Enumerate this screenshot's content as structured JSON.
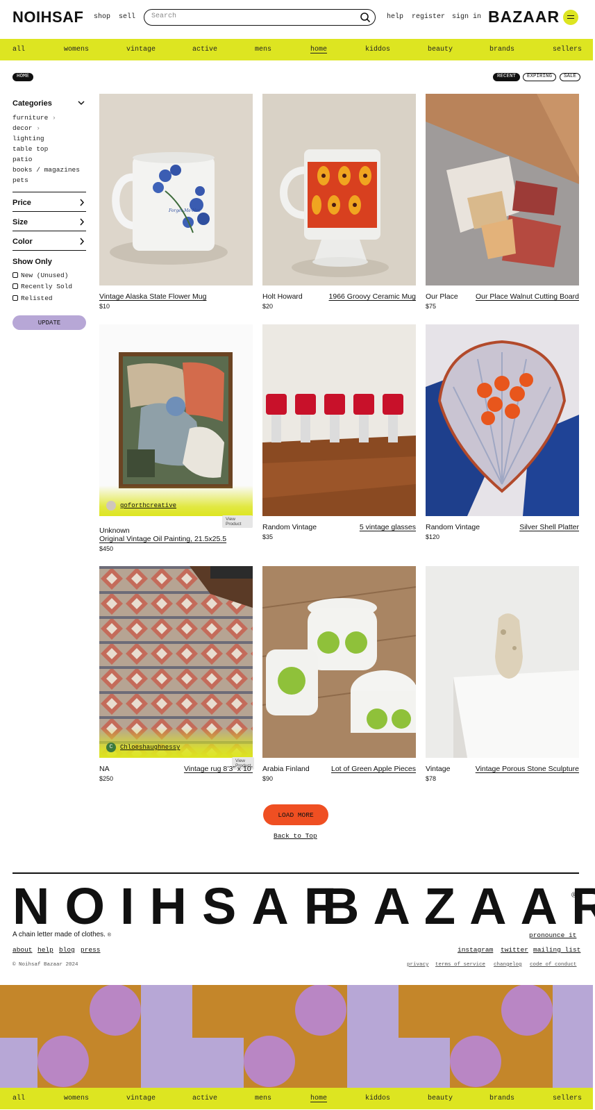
{
  "header": {
    "logo_left": "NOIHSAF",
    "shop": "shop",
    "sell": "sell",
    "search_placeholder": "Search",
    "help": "help",
    "register": "register",
    "sign_in": "sign in",
    "logo_right": "BAZAAR"
  },
  "nav": [
    "all",
    "womens",
    "vintage",
    "active",
    "mens",
    "home",
    "kiddos",
    "beauty",
    "brands",
    "sellers"
  ],
  "nav_active": "home",
  "breadcrumb": "HOME",
  "sort": [
    "RECENT",
    "EXPIRING",
    "SALE"
  ],
  "sidebar": {
    "categories_label": "Categories",
    "categories": [
      "furniture",
      "decor",
      "lighting",
      "table top",
      "patio",
      "books / magazines",
      "pets"
    ],
    "price_label": "Price",
    "size_label": "Size",
    "color_label": "Color",
    "show_only_label": "Show Only",
    "show_only": [
      "New (Unused)",
      "Recently Sold",
      "Relisted"
    ],
    "update_label": "UPDATE"
  },
  "products": [
    {
      "seller": "",
      "title": "Vintage Alaska State Flower Mug",
      "price": "$10"
    },
    {
      "seller": "Holt Howard",
      "title": "1966 Groovy Ceramic Mug",
      "price": "$20"
    },
    {
      "seller": "Our Place",
      "title": "Our Place Walnut Cutting Board",
      "price": "$75"
    },
    {
      "seller": "Unknown",
      "title": "Original Vintage Oil Painting, 21.5x25.5",
      "price": "$450",
      "badge_user": "goforthcreative",
      "view_tag": "View Product"
    },
    {
      "seller": "Random Vintage",
      "title": "5 vintage glasses",
      "price": "$35"
    },
    {
      "seller": "Random Vintage",
      "title": "Silver Shell Platter",
      "price": "$120"
    },
    {
      "seller": "NA",
      "title": "Vintage rug 8’3” x 10’",
      "price": "$250",
      "badge_user": "Chloeshaughnessy",
      "badge_initial": "C",
      "view_tag": "View Product"
    },
    {
      "seller": "Arabia Finland",
      "title": "Lot of Green Apple Pieces",
      "price": "$90"
    },
    {
      "seller": "Vintage",
      "title": "Vintage Porous Stone Sculpture",
      "price": "$78"
    }
  ],
  "load_more": "LOAD MORE",
  "back_to_top": "Back to Top",
  "footer": {
    "big_left": "NOIHSAF",
    "big_right": "BAZAAR",
    "registered": "®",
    "tagline": "A chain letter made of clothes.",
    "tagline_mark": "®",
    "pronounce": "pronounce it",
    "links_left": [
      "about",
      "help",
      "blog",
      "press"
    ],
    "links_right": [
      "instagram",
      "twitter",
      "mailing list"
    ],
    "copyright": "© Noihsaf Bazaar 2024",
    "legal": [
      "privacy",
      "terms of service",
      "changelog",
      "code of conduct"
    ]
  },
  "colors": {
    "accent_yellow": "#dde521",
    "lavender": "#b7a7d6",
    "orange": "#ef4f22",
    "mustard": "#c4862a",
    "pink_circle": "#b986c4"
  }
}
